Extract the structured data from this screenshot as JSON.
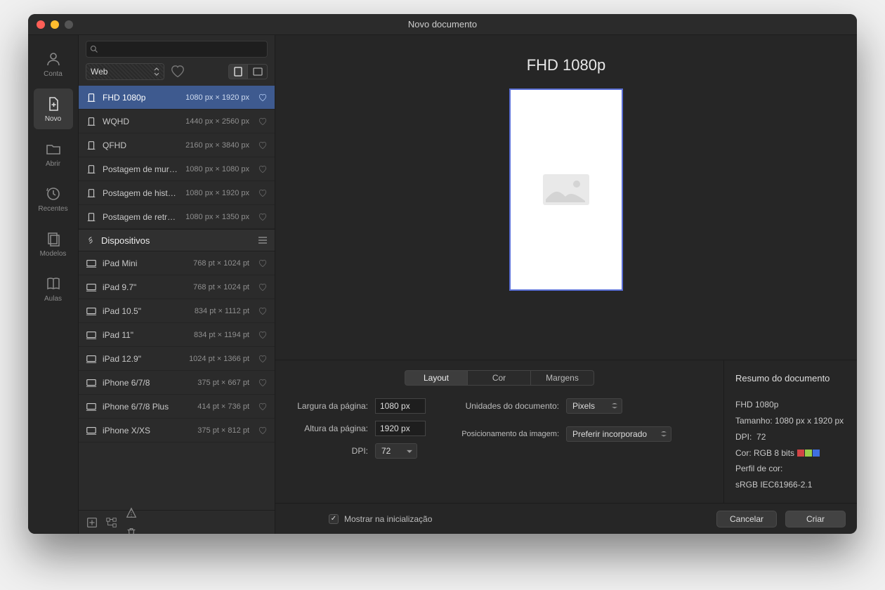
{
  "window": {
    "title": "Novo documento"
  },
  "sidebar": [
    {
      "id": "account",
      "label": "Conta",
      "icon": "user"
    },
    {
      "id": "new",
      "label": "Novo",
      "icon": "new-doc",
      "active": true
    },
    {
      "id": "open",
      "label": "Abrir",
      "icon": "folder"
    },
    {
      "id": "recent",
      "label": "Recentes",
      "icon": "clock"
    },
    {
      "id": "models",
      "label": "Modelos",
      "icon": "stack"
    },
    {
      "id": "classes",
      "label": "Aulas",
      "icon": "book"
    }
  ],
  "search": {
    "placeholder": ""
  },
  "category": {
    "selected": "Web"
  },
  "orientation": {
    "portrait": true
  },
  "presets_web": [
    {
      "name": "FHD 1080p",
      "dims": "1080 px × 1920 px",
      "selected": true
    },
    {
      "name": "WQHD",
      "dims": "1440 px × 2560 px"
    },
    {
      "name": "QFHD",
      "dims": "2160 px × 3840 px"
    },
    {
      "name": "Postagem de mural em…",
      "dims": "1080 px × 1080 px"
    },
    {
      "name": "Postagem de história e…",
      "dims": "1080 px × 1920 px"
    },
    {
      "name": "Postagem de retrato e…",
      "dims": "1080 px × 1350 px"
    }
  ],
  "section_devices": {
    "label": "Dispositivos"
  },
  "presets_devices": [
    {
      "name": "iPad Mini",
      "dims": "768 pt × 1024 pt"
    },
    {
      "name": "iPad 9.7\"",
      "dims": "768 pt × 1024 pt"
    },
    {
      "name": "iPad 10.5\"",
      "dims": "834 pt × 1112 pt"
    },
    {
      "name": "iPad 11\"",
      "dims": "834 pt × 1194 pt"
    },
    {
      "name": "iPad 12.9\"",
      "dims": "1024 pt × 1366 pt"
    },
    {
      "name": "iPhone 6/7/8",
      "dims": "375 pt × 667 pt"
    },
    {
      "name": "iPhone 6/7/8 Plus",
      "dims": "414 pt × 736 pt"
    },
    {
      "name": "iPhone X/XS",
      "dims": "375 pt × 812 pt"
    }
  ],
  "preview": {
    "title": "FHD 1080p"
  },
  "tabs": {
    "layout": "Layout",
    "color": "Cor",
    "margins": "Margens",
    "active": "layout"
  },
  "layout_form": {
    "width_label": "Largura da página:",
    "width_value": "1080 px",
    "height_label": "Altura da página:",
    "height_value": "1920 px",
    "dpi_label": "DPI:",
    "dpi_value": "72",
    "units_label": "Unidades do documento:",
    "units_value": "Pixels",
    "imgpos_label": "Posicionamento da imagem:",
    "imgpos_value": "Preferir incorporado"
  },
  "summary": {
    "heading": "Resumo do documento",
    "name": "FHD 1080p",
    "size_label": "Tamanho:",
    "size_value": "1080 px x 1920 px",
    "dpi_label": "DPI:",
    "dpi_value": "72",
    "color_label": "Cor:",
    "color_value": "RGB 8 bits",
    "profile_label": "Perfil de cor:",
    "profile_value": "sRGB IEC61966-2.1",
    "swatches": [
      "#d24545",
      "#9acd4a",
      "#3f6fe0"
    ]
  },
  "footer": {
    "show_label": "Mostrar na inicialização",
    "show_checked": true,
    "cancel": "Cancelar",
    "create": "Criar"
  }
}
